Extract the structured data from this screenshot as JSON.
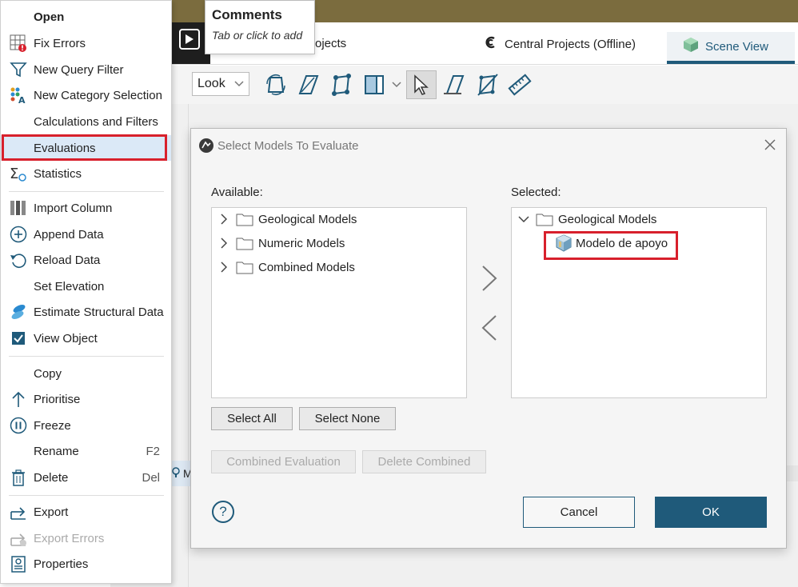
{
  "background_app": {
    "comments_tooltip": {
      "title": "Comments",
      "hint": "Tab or click to add"
    },
    "projects_tab_partial": "ojects",
    "central_tab": "Central Projects (Offline)",
    "scene_tab": "Scene View",
    "look_select_value": "Look",
    "partial_row_text": "M"
  },
  "context_menu": {
    "items": [
      {
        "label": "Open",
        "icon": "none"
      },
      {
        "label": "Fix Errors",
        "icon": "fix-errors-icon"
      },
      {
        "label": "New Query Filter",
        "icon": "funnel-icon"
      },
      {
        "label": "New Category Selection",
        "icon": "category-selection-icon"
      },
      {
        "label": "Calculations and Filters",
        "icon": "none"
      },
      {
        "label": "Evaluations",
        "icon": "none"
      },
      {
        "label": "Statistics",
        "icon": "sigma-icon"
      },
      {
        "label": "Import Column",
        "icon": "import-column-icon"
      },
      {
        "label": "Append Data",
        "icon": "plus-circle-icon"
      },
      {
        "label": "Reload Data",
        "icon": "reload-icon"
      },
      {
        "label": "Set Elevation",
        "icon": "none"
      },
      {
        "label": "Estimate Structural Data",
        "icon": "structural-data-icon"
      },
      {
        "label": "View Object",
        "icon": "checkbox-checked-icon"
      },
      {
        "label": "Copy",
        "icon": "none"
      },
      {
        "label": "Prioritise",
        "icon": "arrow-up-icon"
      },
      {
        "label": "Freeze",
        "icon": "pause-circle-icon"
      },
      {
        "label": "Rename",
        "shortcut": "F2",
        "icon": "none"
      },
      {
        "label": "Delete",
        "shortcut": "Del",
        "icon": "trash-icon"
      },
      {
        "label": "Export",
        "icon": "export-icon"
      },
      {
        "label": "Export Errors",
        "icon": "export-errors-icon",
        "disabled": true
      },
      {
        "label": "Properties",
        "icon": "properties-icon"
      }
    ]
  },
  "dialog": {
    "title": "Select Models To Evaluate",
    "available_label": "Available:",
    "selected_label": "Selected:",
    "available_items": [
      "Geological Models",
      "Numeric Models",
      "Combined Models"
    ],
    "selected_tree": {
      "folder": "Geological Models",
      "children": [
        "Modelo de apoyo"
      ]
    },
    "buttons": {
      "select_all": "Select All",
      "select_none": "Select None",
      "combined_evaluation": "Combined Evaluation",
      "delete_combined": "Delete Combined",
      "cancel": "Cancel",
      "ok": "OK"
    },
    "help": "?"
  },
  "colors": {
    "highlight_red": "#d8202c",
    "accent_blue": "#1f5a7a",
    "menu_selected_bg": "#dbe9f7",
    "topbar": "#7b6c3e"
  }
}
